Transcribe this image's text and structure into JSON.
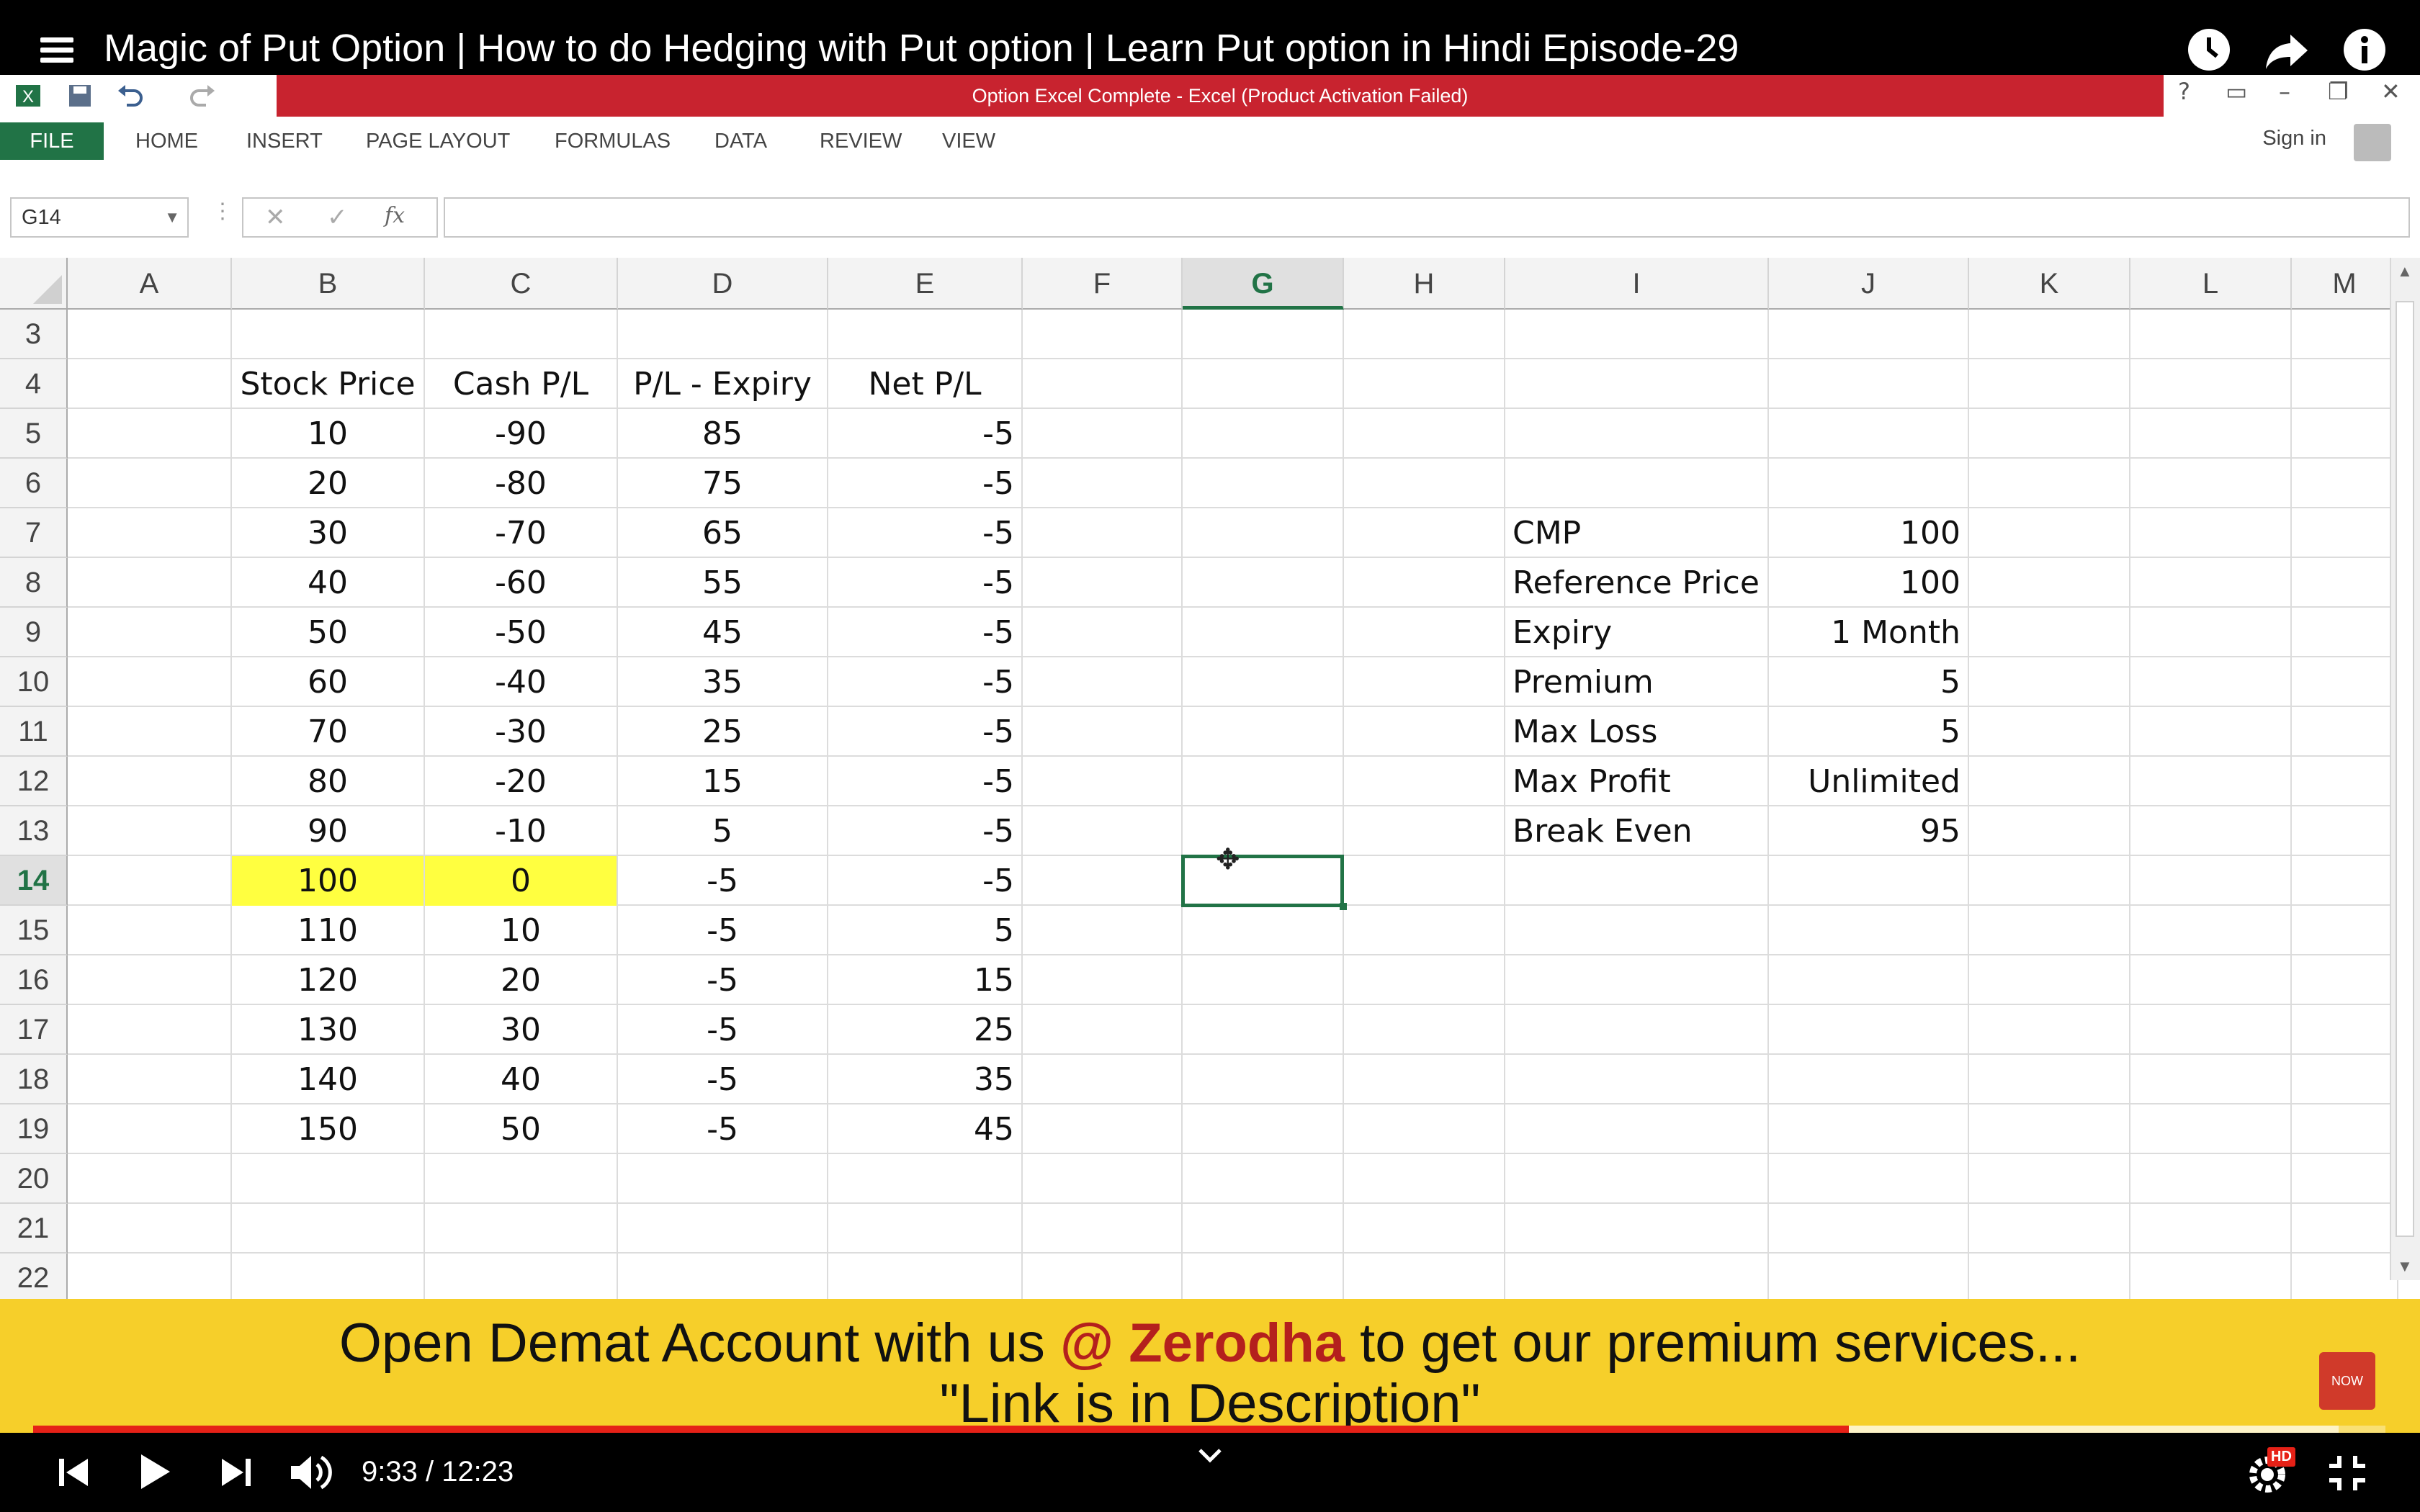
{
  "video": {
    "title": "Magic of Put Option | How to do Hedging with Put option | Learn Put option in Hindi Episode-29",
    "time": "9:33 / 12:23",
    "progress": 0.772,
    "buffered": 0.98,
    "hd_badge": "HD"
  },
  "excel": {
    "window_title": "Option Excel Complete -  Excel (Product Activation Failed)",
    "tabs": [
      "FILE",
      "HOME",
      "INSERT",
      "PAGE LAYOUT",
      "FORMULAS",
      "DATA",
      "REVIEW",
      "VIEW"
    ],
    "sign_in": "Sign in",
    "name_box": "G14",
    "fx_label": "fx",
    "columns": [
      "A",
      "B",
      "C",
      "D",
      "E",
      "F",
      "G",
      "H",
      "I",
      "J",
      "K",
      "L",
      "M"
    ],
    "selected_column": "G",
    "selected_row": "14",
    "rows": [
      "3",
      "4",
      "5",
      "6",
      "7",
      "8",
      "9",
      "10",
      "11",
      "12",
      "13",
      "14",
      "15",
      "16",
      "17",
      "18",
      "19",
      "20",
      "21",
      "22"
    ],
    "table_headers": [
      "Stock Price",
      "Cash P/L",
      "P/L - Expiry",
      "Net P/L"
    ],
    "table_rows": [
      [
        "10",
        "-90",
        "85",
        "-5"
      ],
      [
        "20",
        "-80",
        "75",
        "-5"
      ],
      [
        "30",
        "-70",
        "65",
        "-5"
      ],
      [
        "40",
        "-60",
        "55",
        "-5"
      ],
      [
        "50",
        "-50",
        "45",
        "-5"
      ],
      [
        "60",
        "-40",
        "35",
        "-5"
      ],
      [
        "70",
        "-30",
        "25",
        "-5"
      ],
      [
        "80",
        "-20",
        "15",
        "-5"
      ],
      [
        "90",
        "-10",
        "5",
        "-5"
      ],
      [
        "100",
        "0",
        "-5",
        "-5"
      ],
      [
        "110",
        "10",
        "-5",
        "5"
      ],
      [
        "120",
        "20",
        "-5",
        "15"
      ],
      [
        "130",
        "30",
        "-5",
        "25"
      ],
      [
        "140",
        "40",
        "-5",
        "35"
      ],
      [
        "150",
        "50",
        "-5",
        "45"
      ]
    ],
    "highlight_color": "#ffff40",
    "summary": [
      {
        "label": "CMP",
        "value": "100"
      },
      {
        "label": "Reference Price",
        "value": "100"
      },
      {
        "label": "Expiry",
        "value": "1 Month"
      },
      {
        "label": "Premium",
        "value": "5"
      },
      {
        "label": "Max Loss",
        "value": "5"
      },
      {
        "label": "Max Profit",
        "value": "Unlimited"
      },
      {
        "label": "Break Even",
        "value": "95"
      }
    ]
  },
  "banner": {
    "line1_pre": "Open Demat Account with us ",
    "line1_brand": "@ Zerodha",
    "line1_post": "  to get our premium services...",
    "line2": "\"Link is in Description\"",
    "subscribe": "NOW"
  },
  "colors": {
    "excel_green": "#217346",
    "title_red": "#c8232f",
    "banner_yellow": "#f6cf2a",
    "progress_red": "#e62117"
  }
}
